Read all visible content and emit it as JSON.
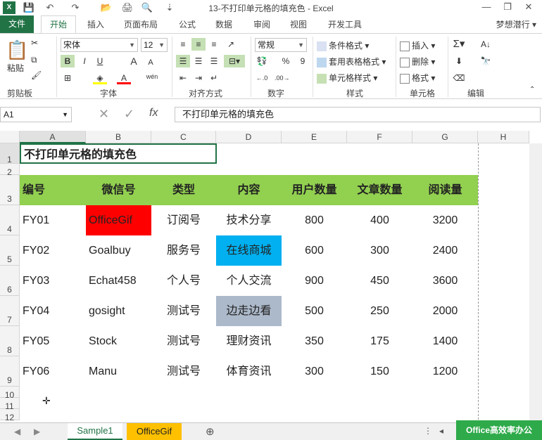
{
  "window": {
    "title": "13-不打印单元格的填充色 - Excel",
    "minimize": "—",
    "restore": "❐",
    "close": "✕"
  },
  "tabs": {
    "file": "文件",
    "home": "开始",
    "insert": "插入",
    "layout": "页面布局",
    "formulas": "公式",
    "data": "数据",
    "review": "审阅",
    "view": "视图",
    "developer": "开发工具"
  },
  "user": "梦想潜行",
  "ribbon": {
    "clipboard": {
      "label": "剪贴板",
      "paste": "粘贴"
    },
    "font": {
      "label": "字体",
      "name": "宋体",
      "size": "12",
      "bold": "B",
      "italic": "I",
      "underline": "U",
      "grow": "A",
      "shrink": "A",
      "phonetic": "wén"
    },
    "alignment": {
      "label": "对齐方式"
    },
    "number": {
      "label": "数字",
      "format": "常规",
      "percent": "%",
      "comma": "9"
    },
    "styles": {
      "label": "样式",
      "conditional": "条件格式",
      "table": "套用表格格式",
      "cell": "单元格样式"
    },
    "cells": {
      "label": "单元格",
      "insert": "插入",
      "delete": "删除",
      "format": "格式"
    },
    "editing": {
      "label": "编辑"
    }
  },
  "formula_bar": {
    "name_box": "A1",
    "content": "不打印单元格的填充色"
  },
  "columns": [
    "A",
    "B",
    "C",
    "D",
    "E",
    "F",
    "G",
    "H"
  ],
  "rows": [
    "1",
    "2",
    "3",
    "4",
    "5",
    "6",
    "7",
    "8",
    "9",
    "10",
    "11",
    "12"
  ],
  "sheet": {
    "title": "不打印单元格的填充色",
    "headers": [
      "编号",
      "微信号",
      "类型",
      "内容",
      "用户数量",
      "文章数量",
      "阅读量"
    ],
    "data": [
      [
        "FY01",
        "OfficeGif",
        "订阅号",
        "技术分享",
        "800",
        "400",
        "3200"
      ],
      [
        "FY02",
        "Goalbuy",
        "服务号",
        "在线商城",
        "600",
        "300",
        "2400"
      ],
      [
        "FY03",
        "Echat458",
        "个人号",
        "个人交流",
        "900",
        "450",
        "3600"
      ],
      [
        "FY04",
        "gosight",
        "测试号",
        "边走边看",
        "500",
        "250",
        "2000"
      ],
      [
        "FY05",
        "Stock",
        "测试号",
        "理财资讯",
        "350",
        "175",
        "1400"
      ],
      [
        "FY06",
        "Manu",
        "测试号",
        "体育资讯",
        "300",
        "150",
        "1200"
      ]
    ],
    "fills": {
      "header": "#92d050",
      "red": "#ff0000",
      "blue": "#00b0f0",
      "gray": "#acb9ca"
    }
  },
  "sheet_tabs": [
    "Sample1",
    "OfficeGif"
  ],
  "watermark": "Office高效率办公"
}
